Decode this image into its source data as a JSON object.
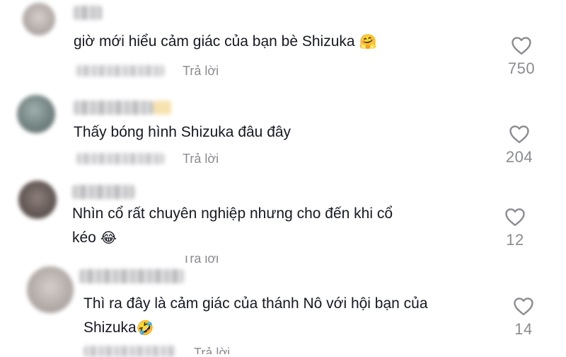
{
  "comments": [
    {
      "text": "giờ mới hiểu cảm giác của bạn bè Shizuka",
      "emoji": "🤗",
      "reply": "Trả lời",
      "likes": "750"
    },
    {
      "text": "Thấy bóng hình Shizuka đâu đây",
      "emoji": "",
      "reply": "Trả lời",
      "likes": "204"
    },
    {
      "text_line1": "Nhìn cổ rất chuyên nghiệp nhưng cho đến khi cổ",
      "text_line2": "kéo",
      "emoji": "😂",
      "reply": "Trả lời",
      "likes": "12"
    },
    {
      "text_line1": "Thì ra đây là cảm giác của thánh Nô với hội bạn của",
      "text_line2": "Shizuka",
      "emoji": "🤣",
      "reply": "Trả lời",
      "likes": "14"
    }
  ],
  "icons": {
    "like": "heart-outline-icon"
  }
}
